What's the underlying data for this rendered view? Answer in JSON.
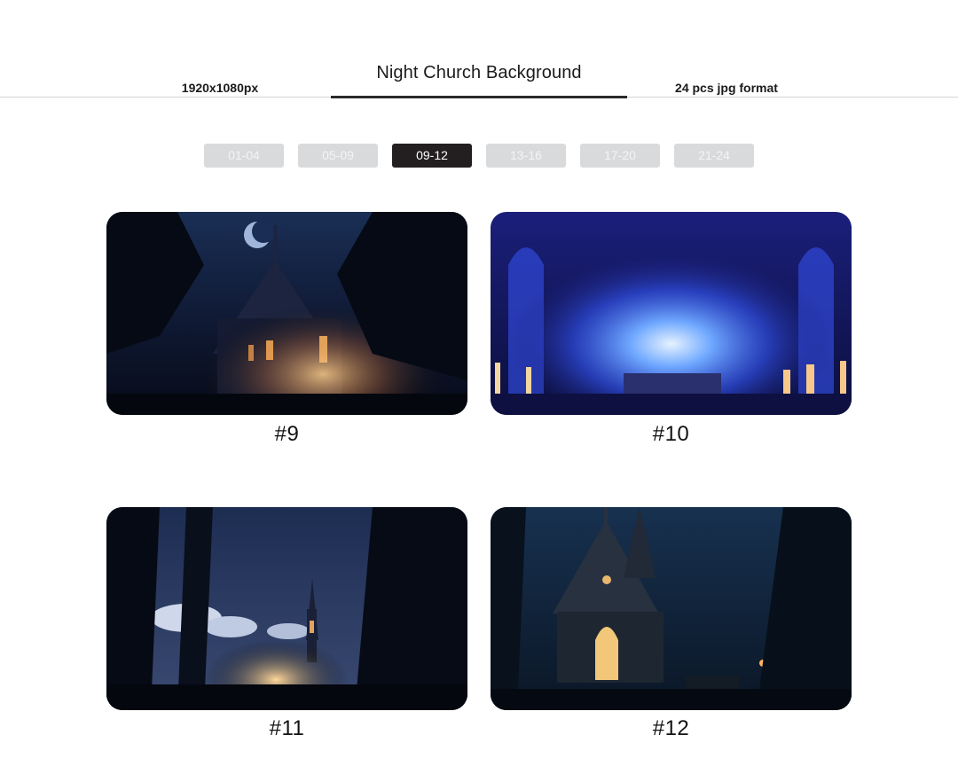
{
  "header": {
    "title": "Night Church Background",
    "resolution": "1920x1080px",
    "format": "24 pcs jpg format"
  },
  "tabs": [
    {
      "label": "01-04",
      "active": false
    },
    {
      "label": "05-09",
      "active": false
    },
    {
      "label": "09-12",
      "active": true
    },
    {
      "label": "13-16",
      "active": false
    },
    {
      "label": "17-20",
      "active": false
    },
    {
      "label": "21-24",
      "active": false
    }
  ],
  "gallery": {
    "items": [
      {
        "caption": "#9",
        "scene": "church-in-forest-with-moon"
      },
      {
        "caption": "#10",
        "scene": "glowing-blue-cathedral-interior"
      },
      {
        "caption": "#11",
        "scene": "forest-path-with-distant-spire"
      },
      {
        "caption": "#12",
        "scene": "gothic-chapel-front-at-night"
      }
    ]
  },
  "colors": {
    "active_tab": "#231f20",
    "inactive_tab": "#d9dadb",
    "night_navy": "#0f1a33",
    "glow_blue": "#3a5cff",
    "candle_orange": "#ffb25a"
  }
}
